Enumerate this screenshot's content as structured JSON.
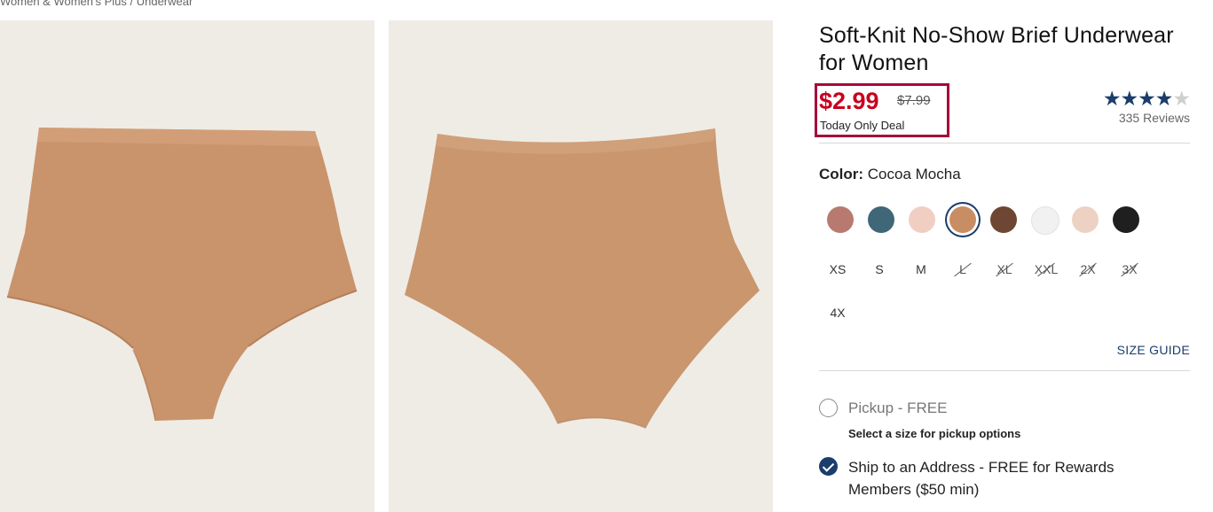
{
  "breadcrumb": "Women & Women's Plus / Underwear",
  "product": {
    "title": "Soft-Knit No-Show Brief Underwear for Women",
    "price_now": "$2.99",
    "price_was": "$7.99",
    "deal_text": "Today Only Deal",
    "rating_stars": 4,
    "reviews": "335 Reviews"
  },
  "color": {
    "label": "Color:",
    "selected": "Cocoa Mocha",
    "swatches": [
      "#b87a70",
      "#3f6778",
      "#f0cfc2",
      "#c98d63",
      "#6e4634",
      "#f1f1f1",
      "#edd1c2",
      "#1f1f1f"
    ],
    "selected_index": 3
  },
  "sizes": [
    {
      "label": "XS",
      "available": true
    },
    {
      "label": "S",
      "available": true
    },
    {
      "label": "M",
      "available": true
    },
    {
      "label": "L",
      "available": false
    },
    {
      "label": "XL",
      "available": false
    },
    {
      "label": "XXL",
      "available": false
    },
    {
      "label": "2X",
      "available": false
    },
    {
      "label": "3X",
      "available": false
    },
    {
      "label": "4X",
      "available": true
    }
  ],
  "size_guide": "SIZE GUIDE",
  "fulfillment": {
    "pickup_label": "Pickup - FREE",
    "pickup_note": "Select a size for pickup options",
    "ship_label": "Ship to an Address - FREE for Rewards Members ($50 min)"
  },
  "colors": {
    "sale": "#c8001e",
    "highlight": "#a5093a",
    "brand": "#1a3d6b",
    "product": "#c9946b"
  }
}
